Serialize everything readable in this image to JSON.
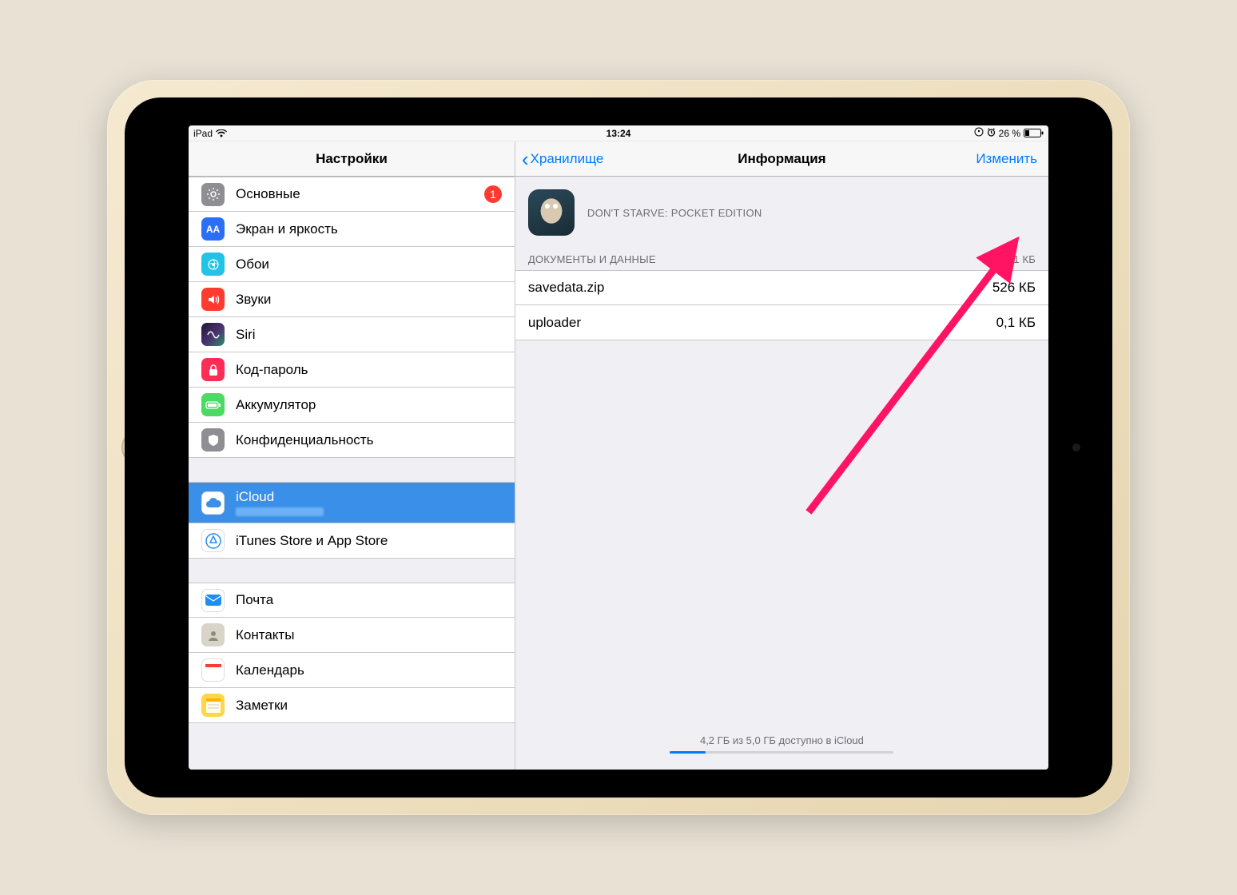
{
  "status": {
    "device": "iPad",
    "time": "13:24",
    "battery_text": "26 %"
  },
  "master": {
    "title": "Настройки",
    "items_group1": [
      {
        "label": "Основные",
        "icon": "gear-icon",
        "badge": "1"
      },
      {
        "label": "Экран и яркость",
        "icon": "display-icon"
      },
      {
        "label": "Обои",
        "icon": "wallpaper-icon"
      },
      {
        "label": "Звуки",
        "icon": "sound-icon"
      },
      {
        "label": "Siri",
        "icon": "siri-icon"
      },
      {
        "label": "Код-пароль",
        "icon": "passcode-icon"
      },
      {
        "label": "Аккумулятор",
        "icon": "battery-icon"
      },
      {
        "label": "Конфиденциальность",
        "icon": "privacy-icon"
      }
    ],
    "items_group2": [
      {
        "label": "iCloud",
        "icon": "icloud-icon",
        "selected": true
      },
      {
        "label": "iTunes Store и App Store",
        "icon": "appstore-icon"
      }
    ],
    "items_group3": [
      {
        "label": "Почта",
        "icon": "mail-icon"
      },
      {
        "label": "Контакты",
        "icon": "contacts-icon"
      },
      {
        "label": "Календарь",
        "icon": "calendar-icon"
      },
      {
        "label": "Заметки",
        "icon": "notes-icon"
      }
    ]
  },
  "detail": {
    "back_label": "Хранилище",
    "title": "Информация",
    "edit_label": "Изменить",
    "app_name": "DON'T STARVE: POCKET EDITION",
    "section_header": "ДОКУМЕНТЫ И ДАННЫЕ",
    "section_total": "526,1 КБ",
    "docs": [
      {
        "name": "savedata.zip",
        "size": "526 КБ"
      },
      {
        "name": "uploader",
        "size": "0,1 КБ"
      }
    ],
    "footer": "4,2 ГБ из 5,0 ГБ доступно в iCloud",
    "storage_used_fraction": 0.16
  }
}
